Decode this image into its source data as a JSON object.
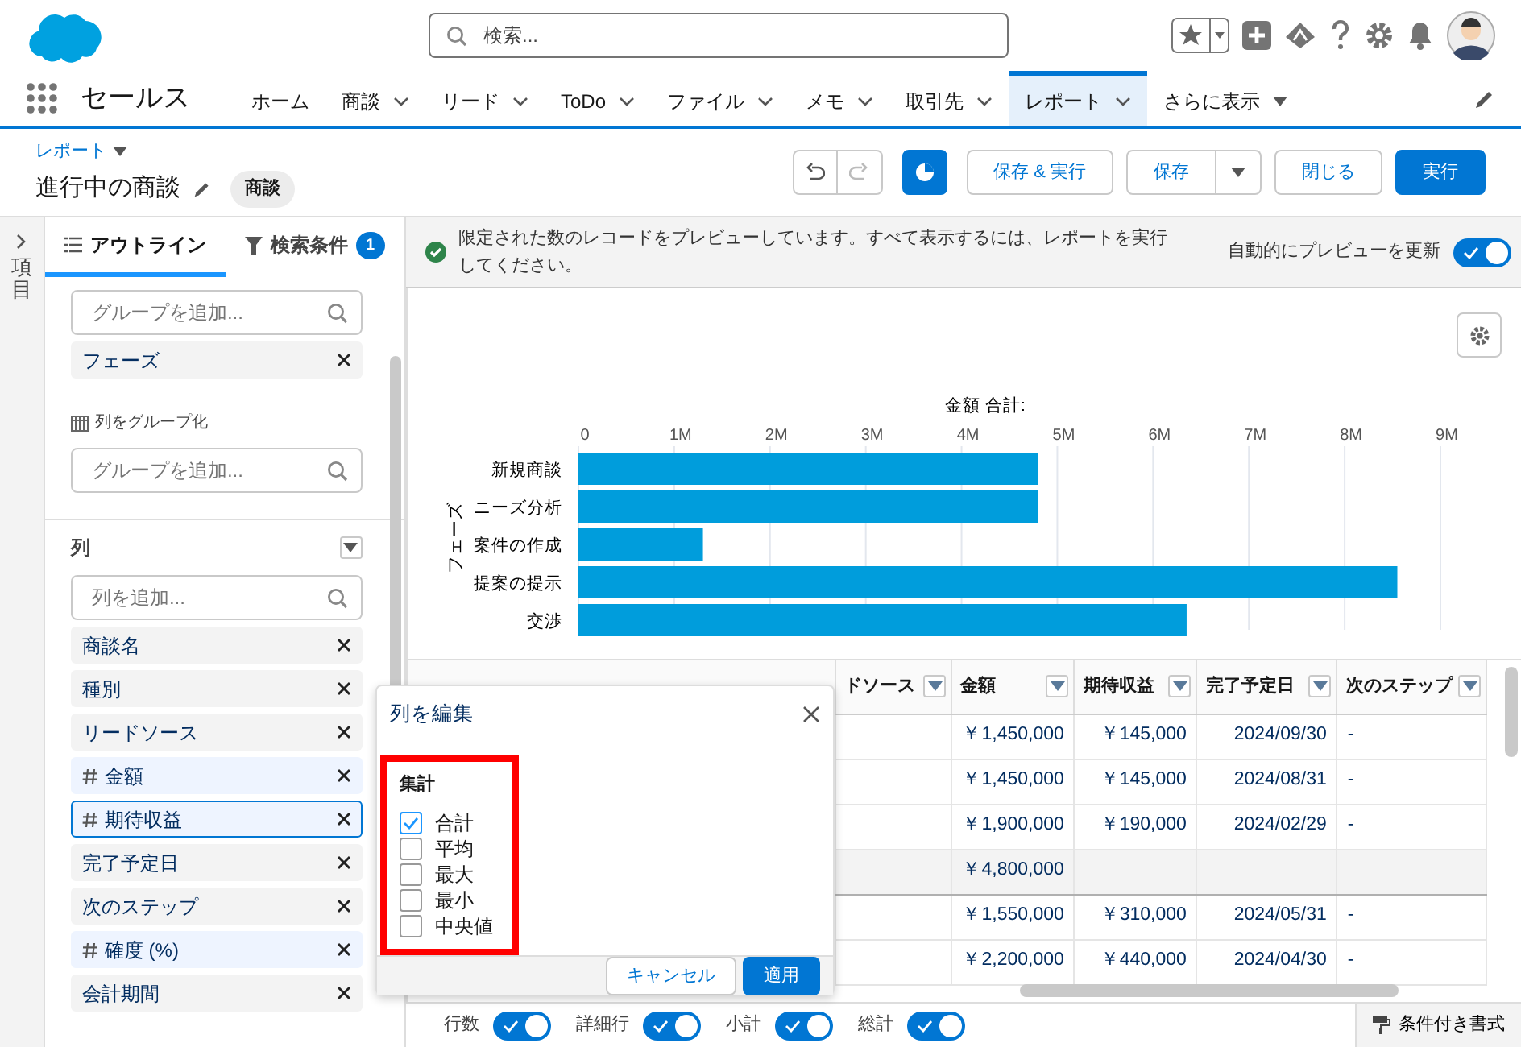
{
  "header": {
    "search": {
      "placeholder": "検索..."
    }
  },
  "app": {
    "name": "セールス"
  },
  "nav_tabs": [
    {
      "label": "ホーム",
      "kind": "plain",
      "selected": false
    },
    {
      "label": "商談",
      "kind": "menu",
      "selected": false
    },
    {
      "label": "リード",
      "kind": "menu",
      "selected": false
    },
    {
      "label": "ToDo",
      "kind": "menu",
      "selected": false
    },
    {
      "label": "ファイル",
      "kind": "menu",
      "selected": false
    },
    {
      "label": "メモ",
      "kind": "menu",
      "selected": false
    },
    {
      "label": "取引先",
      "kind": "menu",
      "selected": false
    },
    {
      "label": "レポート",
      "kind": "menu",
      "selected": true
    },
    {
      "label": "さらに表示",
      "kind": "more",
      "selected": false
    }
  ],
  "report": {
    "breadcrumb": "レポート",
    "title": "進行中の商談",
    "object_badge": "商談"
  },
  "toolbar": {
    "undo": {
      "disabled": false
    },
    "redo": {
      "disabled": true
    },
    "buttons": [
      {
        "label": "保存 & 実行",
        "kind": "outline"
      },
      {
        "label": "保存",
        "kind": "split"
      },
      {
        "label": "閉じる",
        "kind": "outline"
      },
      {
        "label": "実行",
        "kind": "primary"
      }
    ]
  },
  "side_rail": {
    "label": "項目"
  },
  "panel_tabs": [
    {
      "label": "アウトライン",
      "selected": true
    },
    {
      "label": "検索条件",
      "selected": false,
      "count": "1"
    }
  ],
  "row_groups": {
    "placeholder": "グループを追加...",
    "items": [
      {
        "label": "フェーズ"
      }
    ]
  },
  "column_groups": {
    "label": "列をグループ化",
    "placeholder": "グループを追加..."
  },
  "columns_section": {
    "title": "列",
    "placeholder": "列を追加...",
    "items": [
      {
        "label": "商談名",
        "numeric": false,
        "selected": false
      },
      {
        "label": "種別",
        "numeric": false,
        "selected": false
      },
      {
        "label": "リードソース",
        "numeric": false,
        "selected": false
      },
      {
        "label": "金額",
        "numeric": true,
        "selected": false
      },
      {
        "label": "期待収益",
        "numeric": true,
        "selected": true
      },
      {
        "label": "完了予定日",
        "numeric": false,
        "selected": false
      },
      {
        "label": "次のステップ",
        "numeric": false,
        "selected": false
      },
      {
        "label": "確度 (%)",
        "numeric": true,
        "selected": false
      },
      {
        "label": "会計期間",
        "numeric": false,
        "selected": false
      }
    ]
  },
  "notice": {
    "text": "限定された数のレコードをプレビューしています。すべて表示するには、レポートを実行してください。",
    "auto_preview": {
      "label": "自動的にプレビューを更新",
      "on": true
    }
  },
  "chart": {
    "chart_data": {
      "type": "bar",
      "orientation": "horizontal",
      "title": "金額 合計:",
      "ylabel": "フェーズ",
      "categories": [
        "新規商談",
        "ニーズ分析",
        "案件の作成",
        "提案の提示",
        "交渉"
      ],
      "series": [
        {
          "color": "#009ddc",
          "values": [
            4800000,
            4800000,
            1300000,
            8550000,
            6350000
          ]
        }
      ],
      "xlim": [
        0,
        9000000
      ],
      "grid": true,
      "xticks": [
        {
          "value": 0,
          "label": "0"
        },
        {
          "value": 1000000,
          "label": "1M"
        },
        {
          "value": 2000000,
          "label": "2M"
        },
        {
          "value": 3000000,
          "label": "3M"
        },
        {
          "value": 4000000,
          "label": "4M"
        },
        {
          "value": 5000000,
          "label": "5M"
        },
        {
          "value": 6000000,
          "label": "6M"
        },
        {
          "value": 7000000,
          "label": "7M"
        },
        {
          "value": 8000000,
          "label": "8M"
        },
        {
          "value": 9000000,
          "label": "9M"
        }
      ]
    }
  },
  "table": {
    "columns": [
      {
        "label": "ドソース"
      },
      {
        "label": "金額"
      },
      {
        "label": "期待収益"
      },
      {
        "label": "完了予定日"
      },
      {
        "label": "次のステップ"
      }
    ],
    "rows": [
      {
        "kind": "detail",
        "amount": "￥1,450,000",
        "expected_revenue": "￥145,000",
        "close_date": "2024/09/30",
        "next_step": "-"
      },
      {
        "kind": "detail",
        "amount": "￥1,450,000",
        "expected_revenue": "￥145,000",
        "close_date": "2024/08/31",
        "next_step": "-"
      },
      {
        "kind": "detail",
        "amount": "￥1,900,000",
        "expected_revenue": "￥190,000",
        "close_date": "2024/02/29",
        "next_step": "-"
      },
      {
        "kind": "subtotal",
        "amount": "￥4,800,000"
      },
      {
        "kind": "detail",
        "amount": "￥1,550,000",
        "expected_revenue": "￥310,000",
        "close_date": "2024/05/31",
        "next_step": "-"
      },
      {
        "kind": "detail",
        "amount": "￥2,200,000",
        "expected_revenue": "￥440,000",
        "close_date": "2024/04/30",
        "next_step": "-"
      }
    ]
  },
  "summary_toggles": [
    {
      "label": "行数",
      "on": true
    },
    {
      "label": "詳細行",
      "on": true
    },
    {
      "label": "小計",
      "on": true
    },
    {
      "label": "総計",
      "on": true
    }
  ],
  "conditional_format": {
    "label": "条件付き書式"
  },
  "edit_popover": {
    "title": "列を編集",
    "section": "集計",
    "highlighted": true,
    "options": [
      {
        "label": "合計",
        "checked": true
      },
      {
        "label": "平均",
        "checked": false
      },
      {
        "label": "最大",
        "checked": false
      },
      {
        "label": "最小",
        "checked": false
      },
      {
        "label": "中央値",
        "checked": false
      }
    ],
    "buttons": [
      {
        "label": "キャンセル",
        "kind": "neutral"
      },
      {
        "label": "適用",
        "kind": "brand"
      }
    ]
  }
}
